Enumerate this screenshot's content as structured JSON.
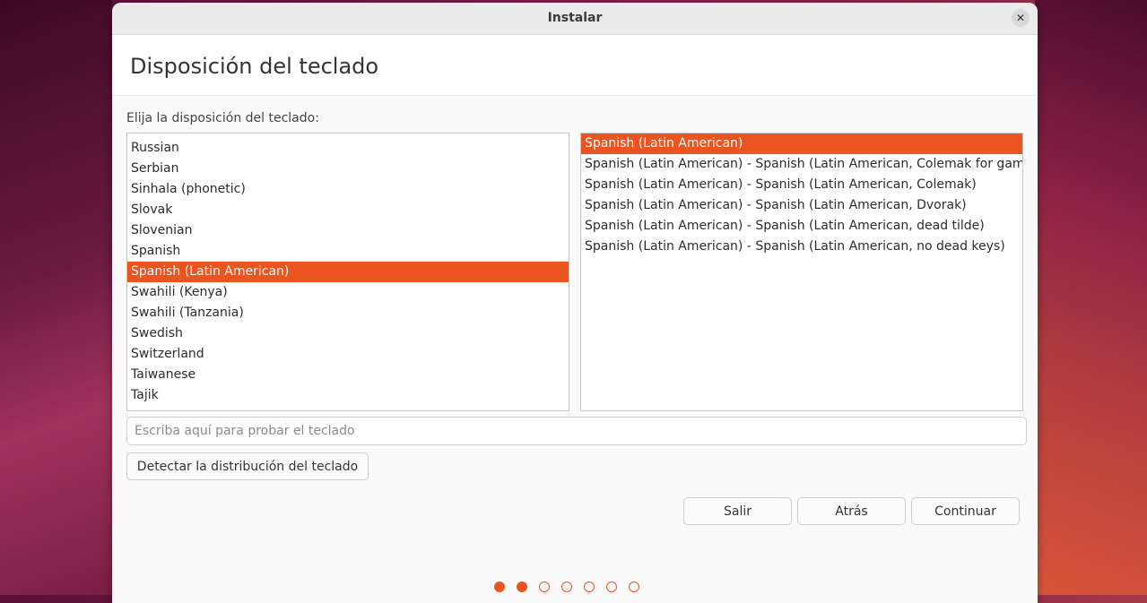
{
  "window": {
    "title": "Instalar",
    "close_icon": "close-icon"
  },
  "page": {
    "title": "Disposición del teclado",
    "prompt": "Elija la disposición del teclado:"
  },
  "layouts": [
    {
      "label": "Russian",
      "selected": false
    },
    {
      "label": "Serbian",
      "selected": false
    },
    {
      "label": "Sinhala (phonetic)",
      "selected": false
    },
    {
      "label": "Slovak",
      "selected": false
    },
    {
      "label": "Slovenian",
      "selected": false
    },
    {
      "label": "Spanish",
      "selected": false
    },
    {
      "label": "Spanish (Latin American)",
      "selected": true
    },
    {
      "label": "Swahili (Kenya)",
      "selected": false
    },
    {
      "label": "Swahili (Tanzania)",
      "selected": false
    },
    {
      "label": "Swedish",
      "selected": false
    },
    {
      "label": "Switzerland",
      "selected": false
    },
    {
      "label": "Taiwanese",
      "selected": false
    },
    {
      "label": "Tajik",
      "selected": false
    }
  ],
  "variants": [
    {
      "label": "Spanish (Latin American)",
      "selected": true
    },
    {
      "label": "Spanish (Latin American) - Spanish (Latin American, Colemak for gaming)",
      "selected": false
    },
    {
      "label": "Spanish (Latin American) - Spanish (Latin American, Colemak)",
      "selected": false
    },
    {
      "label": "Spanish (Latin American) - Spanish (Latin American, Dvorak)",
      "selected": false
    },
    {
      "label": "Spanish (Latin American) - Spanish (Latin American, dead tilde)",
      "selected": false
    },
    {
      "label": "Spanish (Latin American) - Spanish (Latin American, no dead keys)",
      "selected": false
    }
  ],
  "test_input": {
    "placeholder": "Escriba aquí para probar el teclado",
    "value": ""
  },
  "buttons": {
    "detect": "Detectar la distribución del teclado",
    "quit": "Salir",
    "back": "Atrás",
    "continue": "Continuar"
  },
  "progress": {
    "total_steps": 7,
    "completed_steps": 2
  },
  "colors": {
    "accent": "#e95420"
  }
}
